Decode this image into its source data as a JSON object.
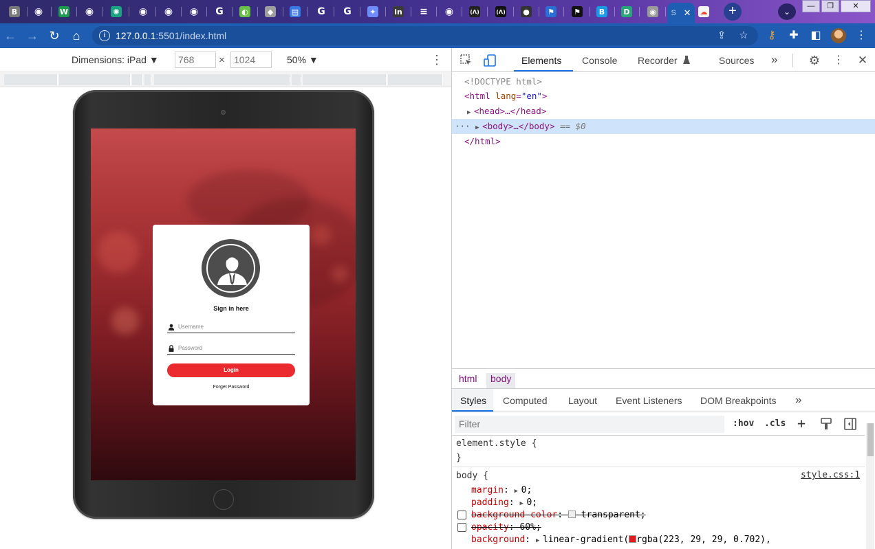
{
  "browser": {
    "tab_favicons": [
      {
        "icon": "bootstrap-icon",
        "glyph": "B",
        "color": "#7a7a7a"
      },
      {
        "icon": "globe-icon",
        "glyph": "◉",
        "color": "#ffffff"
      },
      {
        "icon": "webflow-icon",
        "glyph": "W",
        "color": "#1c9b4f"
      },
      {
        "icon": "globe-icon",
        "glyph": "◉",
        "color": "#ffffff"
      },
      {
        "icon": "chatgpt-icon",
        "glyph": "✺",
        "color": "#19a37f"
      },
      {
        "icon": "globe-icon",
        "glyph": "◉",
        "color": "#ffffff"
      },
      {
        "icon": "globe-icon",
        "glyph": "◉",
        "color": "#ffffff"
      },
      {
        "icon": "globe-icon",
        "glyph": "◉",
        "color": "#ffffff"
      },
      {
        "icon": "google-icon",
        "glyph": "G",
        "color": "#ffffff"
      },
      {
        "icon": "green-circle-icon",
        "glyph": "◐",
        "color": "#6abf4b"
      },
      {
        "icon": "layers-icon",
        "glyph": "◆",
        "color": "#9e9e9e"
      },
      {
        "icon": "docs-icon",
        "glyph": "▤",
        "color": "#3b78e7"
      },
      {
        "icon": "google-icon",
        "glyph": "G",
        "color": "#ffffff"
      },
      {
        "icon": "google-icon",
        "glyph": "G",
        "color": "#ffffff"
      },
      {
        "icon": "sparkle-icon",
        "glyph": "✦",
        "color": "#6f8cff"
      },
      {
        "icon": "linkedin-icon",
        "glyph": "in",
        "color": "#3a3a3a"
      },
      {
        "icon": "stack-icon",
        "glyph": "≡",
        "color": "#ffffff"
      },
      {
        "icon": "globe-icon",
        "glyph": "◉",
        "color": "#ffffff"
      },
      {
        "icon": "code-bracket-icon",
        "glyph": "(Λ)",
        "color": "#222222"
      },
      {
        "icon": "code-bracket-icon",
        "glyph": "(Λ)",
        "color": "#111111"
      },
      {
        "icon": "github-icon",
        "glyph": "●",
        "color": "#333333"
      },
      {
        "icon": "flag-outline-icon",
        "glyph": "⚑",
        "color": "#2b6fd6"
      },
      {
        "icon": "flag-icon",
        "glyph": "⚑",
        "color": "#111111"
      },
      {
        "icon": "bootstrap-blue-icon",
        "glyph": "B",
        "color": "#1a9be8"
      },
      {
        "icon": "d-icon",
        "glyph": "D",
        "color": "#2aa578"
      },
      {
        "icon": "globe-gray-icon",
        "glyph": "◉",
        "color": "#9a9a9a"
      }
    ],
    "active_tab_favicon": "S",
    "active_tab_close": "✕",
    "extra_tab_glyph": "☁",
    "new_tab_glyph": "+",
    "tab_search_glyph": "⌄",
    "window_controls": {
      "minimize": "—",
      "maximize": "❐",
      "close": "✕"
    },
    "nav": {
      "back": "←",
      "forward": "→",
      "reload": "↻",
      "home": "⌂"
    },
    "url_host": "127.0.0.1",
    "url_rest": ":5501/index.html",
    "omnibox_icons": {
      "share": "⇪",
      "star": "☆"
    },
    "extension_icons": {
      "key": "⚷",
      "puzzle": "✚",
      "sidepanel": "◧",
      "menu": "⋮"
    }
  },
  "device_toolbar": {
    "dimensions_label": "Dimensions: iPad ▼",
    "width": "768",
    "height": "1024",
    "times": "×",
    "zoom": "50% ▼",
    "more": "⋮"
  },
  "page": {
    "heading": "Sign in here",
    "username_placeholder": "Username",
    "password_placeholder": "Password",
    "login_label": "Login",
    "forgot_label": "Forget Password",
    "accent": "#ea2a2e"
  },
  "devtools": {
    "tabs": [
      "Elements",
      "Console",
      "Recorder",
      "Sources"
    ],
    "recorder_icon": "flask-icon",
    "more_tabs": "»",
    "dom": {
      "doctype": "<!DOCTYPE html>",
      "html_open_tag": "<html",
      "html_attr": "lang",
      "html_attr_value": "\"en\"",
      "html_close_bracket": ">",
      "head": "<head>…</head>",
      "body": "<body>…</body>",
      "body_suffix": "== $0",
      "html_close": "</html>",
      "ellipsis": "···"
    },
    "breadcrumbs": [
      "html",
      "body"
    ],
    "style_tabs": [
      "Styles",
      "Computed",
      "Layout",
      "Event Listeners",
      "DOM Breakpoints"
    ],
    "style_more": "»",
    "filter_placeholder": "Filter",
    "hov": ":hov",
    "cls": ".cls",
    "plus": "+",
    "styles": {
      "element_style_open": "element.style {",
      "close_brace": "}",
      "body_selector": "body {",
      "source": "style.css:1",
      "props": [
        {
          "name": "margin",
          "value": "0;",
          "struck": false
        },
        {
          "name": "padding",
          "value": "0;",
          "struck": false
        },
        {
          "name": "background-color",
          "value": "transparent;",
          "struck": true
        },
        {
          "name": "opacity",
          "value": "60%;",
          "struck": true
        },
        {
          "name": "background",
          "value": "linear-gradient(",
          "extra": "rgba(223, 29, 29, 0.702),",
          "struck": false
        }
      ],
      "swatch_color": "#df1d1d"
    }
  }
}
